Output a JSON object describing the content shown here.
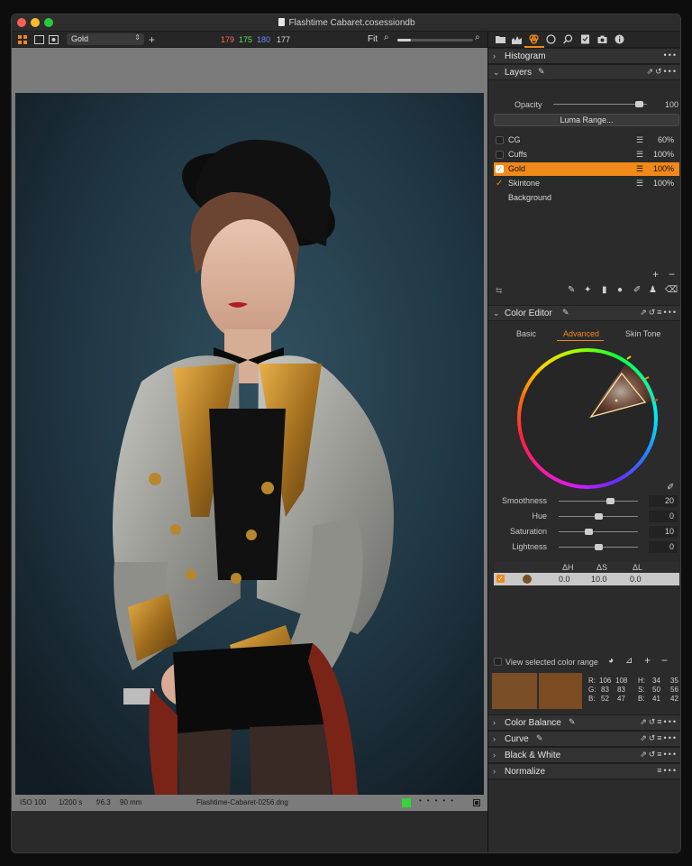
{
  "window": {
    "title": "Flashtime Cabaret.cosessiondb"
  },
  "toolbar": {
    "preset_value": "Gold",
    "rgb": {
      "r": "179",
      "g": "175",
      "b": "180",
      "l": "177"
    },
    "zoom_label": "Fit",
    "zoom_level": 0.18
  },
  "panel_tabs": [
    "folder-icon",
    "histogram-icon",
    "color-icon",
    "circle-icon",
    "search-icon",
    "checklist-icon",
    "camera-icon",
    "info-icon"
  ],
  "sections": {
    "histogram": "Histogram",
    "layers": "Layers",
    "color_editor": "Color Editor",
    "color_balance": "Color Balance",
    "curve": "Curve",
    "black_white": "Black & White",
    "normalize": "Normalize"
  },
  "layers": {
    "opacity_label": "Opacity",
    "opacity_value": "100",
    "luma_button": "Luma Range...",
    "rows": [
      {
        "name": "CG",
        "pct": "60%",
        "checked": false,
        "selected": false
      },
      {
        "name": "Cuffs",
        "pct": "100%",
        "checked": false,
        "selected": false
      },
      {
        "name": "Gold",
        "pct": "100%",
        "checked": true,
        "selected": true
      },
      {
        "name": "Skintone",
        "pct": "100%",
        "checked": true,
        "selected": false
      },
      {
        "name": "Background",
        "pct": "",
        "checked": false,
        "selected": false
      }
    ]
  },
  "color_editor": {
    "tabs": [
      "Basic",
      "Advanced",
      "Skin Tone"
    ],
    "active_tab": "Advanced",
    "sliders": [
      {
        "label": "Smoothness",
        "value": "20",
        "pos": 0.65
      },
      {
        "label": "Hue",
        "value": "0",
        "pos": 0.5
      },
      {
        "label": "Saturation",
        "value": "10",
        "pos": 0.38
      },
      {
        "label": "Lightness",
        "value": "0",
        "pos": 0.5
      }
    ],
    "table": {
      "headers": [
        "ΔH",
        "ΔS",
        "ΔL"
      ],
      "row": [
        "0.0",
        "10.0",
        "0.0"
      ]
    },
    "view_selected": "View selected color range",
    "swatch_color": "#7a4f27",
    "readout": {
      "r1": "R:",
      "r1a": "106",
      "r1b": "108",
      "h": "H:",
      "ha": "34",
      "hb": "35",
      "g1": "G:",
      "g1a": "83",
      "g1b": "83",
      "s": "S:",
      "sa": "50",
      "sb": "56",
      "b1": "B:",
      "b1a": "52",
      "b1b": "47",
      "b": "B:",
      "ba": "41",
      "bb": "42"
    }
  },
  "status": {
    "iso": "ISO 100",
    "shutter": "1/200 s",
    "aperture": "f/6.3",
    "focal": "90 mm",
    "filename": "Flashtime-Cabaret-0256.dng"
  },
  "colors": {
    "accent": "#f0891a",
    "selected_row": "#f0891a",
    "rgb_r": "#ff6464",
    "rgb_g": "#5ee05e",
    "rgb_b": "#6f8cff",
    "status_dot": "#37d437"
  }
}
